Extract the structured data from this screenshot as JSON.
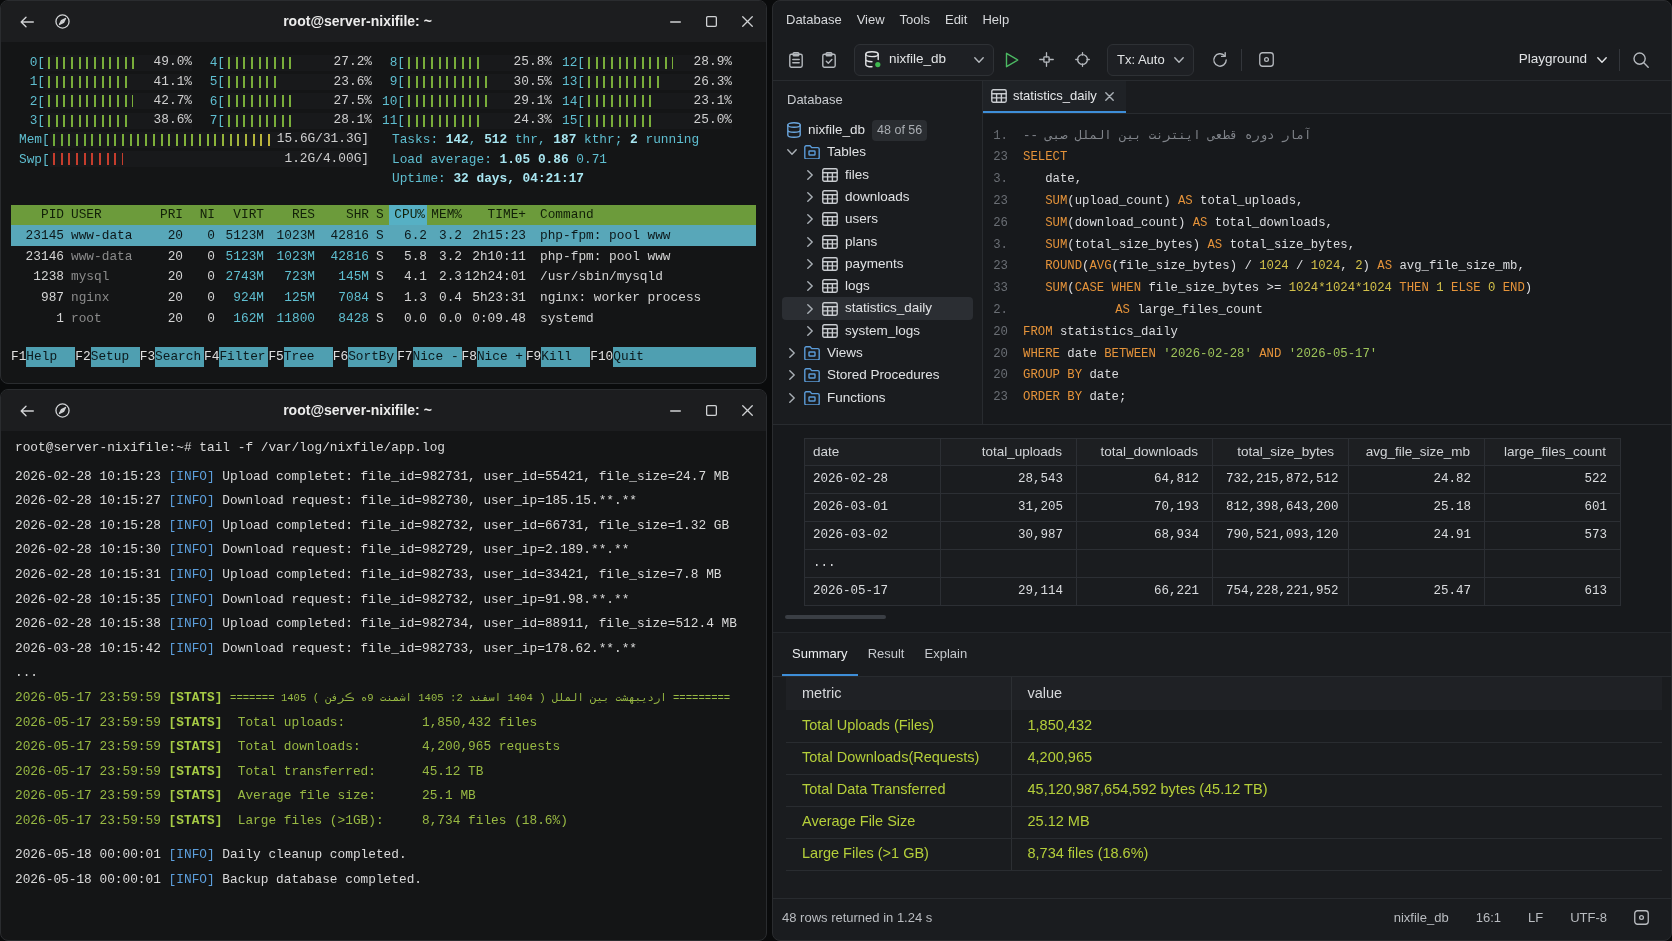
{
  "htop_window": {
    "title": "root@server-nixifile: ~",
    "cpu_meters": [
      {
        "label": "0[",
        "level": 0.61,
        "reading": "49.0%"
      },
      {
        "label": "1[",
        "level": 0.56,
        "reading": "41.1%"
      },
      {
        "label": "2[",
        "level": 0.6,
        "reading": "42.7%"
      },
      {
        "label": "3[",
        "level": 0.56,
        "reading": "38.6%"
      },
      {
        "label": "4[",
        "level": 0.49,
        "reading": "27.2%"
      },
      {
        "label": "5[",
        "level": 0.35,
        "reading": "23.6%"
      },
      {
        "label": "6[",
        "level": 0.45,
        "reading": "27.5%"
      },
      {
        "label": "7[",
        "level": 0.45,
        "reading": "28.1%"
      },
      {
        "label": "8[",
        "level": 0.52,
        "reading": "25.8%"
      },
      {
        "label": "9[",
        "level": 0.56,
        "reading": "30.5%"
      },
      {
        "label": "10[",
        "level": 0.56,
        "reading": "29.1%"
      },
      {
        "label": "11[",
        "level": 0.52,
        "reading": "24.3%"
      },
      {
        "label": "12[",
        "level": 0.6,
        "reading": "28.9%"
      },
      {
        "label": "13[",
        "level": 0.51,
        "reading": "26.3%"
      },
      {
        "label": "14[",
        "level": 0.45,
        "reading": "23.1%"
      },
      {
        "label": "15[",
        "level": 0.47,
        "reading": "25.0%"
      }
    ],
    "memory_meters": [
      {
        "kind": "mem",
        "label": "Mem[",
        "level": 0.71,
        "reading": "15.6G/31.3G]"
      },
      {
        "kind": "swap",
        "label": "Swp[",
        "level": 0.23,
        "reading": "1.2G/4.00G]"
      }
    ],
    "system_info": [
      {
        "label": "Tasks:",
        "value": "**142**, **512** thr, **187** kthr; **2** running"
      },
      {
        "label": "Load average:",
        "value": "**1.05** **0.86** 0.71"
      },
      {
        "label": "Uptime:",
        "value": "**32 days, 04:21:17**"
      }
    ],
    "process_table": {
      "columns": [
        {
          "label": "PID",
          "sorted": false
        },
        {
          "label": "USER",
          "sorted": false
        },
        {
          "label": "PRI",
          "sorted": false
        },
        {
          "label": "NI",
          "sorted": false
        },
        {
          "label": "VIRT",
          "sorted": false
        },
        {
          "label": "RES",
          "sorted": false
        },
        {
          "label": "SHR",
          "sorted": false
        },
        {
          "label": "S",
          "sorted": false
        },
        {
          "label": "CPU%",
          "sorted": true
        },
        {
          "label": "MEM%",
          "sorted": false
        },
        {
          "label": "TIME+",
          "sorted": false
        },
        {
          "label": "Command",
          "sorted": false
        }
      ],
      "rows": [
        {
          "selected": true,
          "cells": [
            "23145",
            "www-data",
            "20",
            "0",
            "5123M",
            "1023M",
            "42816",
            "S",
            "6.2",
            "3.2",
            "2h15:23",
            "php-fpm: pool www"
          ]
        },
        {
          "selected": false,
          "cells": [
            "23146",
            "www-data",
            "20",
            "0",
            "5123M",
            "1023M",
            "42816",
            "S",
            "5.8",
            "3.2",
            "2h10:11",
            "php-fpm: pool www"
          ]
        },
        {
          "selected": false,
          "cells": [
            "1238",
            "mysql",
            "20",
            "0",
            "2743M",
            "723M",
            "145M",
            "S",
            "4.1",
            "2.3",
            "12h24:01",
            "/usr/sbin/mysqld"
          ]
        },
        {
          "selected": false,
          "cells": [
            "987",
            "nginx",
            "20",
            "0",
            "924M",
            "125M",
            "7084",
            "S",
            "1.3",
            "0.4",
            "5h23:31",
            "nginx: worker process"
          ]
        },
        {
          "selected": false,
          "cells": [
            "1",
            "root",
            "20",
            "0",
            "162M",
            "11800",
            "8428",
            "S",
            "0.0",
            "0.0",
            "0:09.48",
            "systemd"
          ]
        }
      ]
    },
    "function_keys": [
      {
        "key": "F1",
        "label": "Help"
      },
      {
        "key": "F2",
        "label": "Setup"
      },
      {
        "key": "F3",
        "label": "Search"
      },
      {
        "key": "F4",
        "label": "Filter"
      },
      {
        "key": "F5",
        "label": "Tree"
      },
      {
        "key": "F6",
        "label": "SortBy"
      },
      {
        "key": "F7",
        "label": "Nice -"
      },
      {
        "key": "F8",
        "label": "Nice +"
      },
      {
        "key": "F9",
        "label": "Kill"
      },
      {
        "key": "F10",
        "label": "Quit"
      }
    ]
  },
  "log_window": {
    "title": "root@server-nixifile: ~",
    "prompt": "root@server-nixifile:~# tail -f /var/log/nixfile/app.log",
    "groups": [
      [
        {
          "kind": "info",
          "time": "2026-02-28 10:15:23",
          "tag": "[INFO]",
          "message": "Upload completet: file_id=982731, user_id=55421, file_size=24.7 MB"
        },
        {
          "kind": "info",
          "time": "2026-02-28 10:15:27",
          "tag": "[INFO]",
          "message": "Download request: file_id=982730, user_ip=185.15.**.**"
        },
        {
          "kind": "info",
          "time": "2026-02-28 10:15:28",
          "tag": "[INFO]",
          "message": "Upload completed: file_id=982732, user_id=66731, file_size=1.32 GB"
        },
        {
          "kind": "info",
          "time": "2026-02-28 10:15:30",
          "tag": "[INFO]",
          "message": "Download request: file_id=982729, user_ip=2.189.**.**"
        },
        {
          "kind": "info",
          "time": "2026-02-28 10:15:31",
          "tag": "[INFO]",
          "message": "Upload completed: file_id=982733, user_id=33421, file_size=7.8 MB"
        },
        {
          "kind": "info",
          "time": "2026-02-28 10:15:35",
          "tag": "[INFO]",
          "message": "Download request: file_id=982732, user_ip=91.98.**.**"
        },
        {
          "kind": "info",
          "time": "2026-02-28 10:15:38",
          "tag": "[INFO]",
          "message": "Upload completed: file_id=982734, user_id=88911, file_size=512.4 MB"
        },
        {
          "kind": "info",
          "time": "2026-03-28 10:15:42",
          "tag": "[INFO]",
          "message": "Download request: file_id=982733, user_ip=178.62.**.**"
        },
        {
          "kind": "plain",
          "message": "..."
        },
        {
          "kind": "banner",
          "time": "2026-05-17 23:59:59",
          "tag": "[STATS]",
          "message": "======= 1405 اردیبهشت بین الملل ( 1404 اسفند 2: 1405 اشمنت 9ه ڪرفن ) ========="
        },
        {
          "kind": "stats",
          "time": "2026-05-17 23:59:59",
          "tag": "[STATS]",
          "label": "Total uploads:",
          "value": "1,850,432 files"
        },
        {
          "kind": "stats",
          "time": "2026-05-17 23:59:59",
          "tag": "[STATS]",
          "label": "Total downloads:",
          "value": "4,200,965 requests"
        },
        {
          "kind": "stats",
          "time": "2026-05-17 23:59:59",
          "tag": "[STATS]",
          "label": "Total transferred:",
          "value": "45.12 TB"
        },
        {
          "kind": "stats",
          "time": "2026-05-17 23:59:59",
          "tag": "[STATS]",
          "label": "Average file size:",
          "value": "25.1 MB"
        },
        {
          "kind": "stats",
          "time": "2026-05-17 23:59:59",
          "tag": "[STATS]",
          "label": "Large files (>1GB):",
          "value": "8,734 files (18.6%)"
        }
      ],
      [
        {
          "kind": "info",
          "time": "2026-05-18 00:00:01",
          "tag": "[INFO]",
          "message": "Daily cleanup completed."
        },
        {
          "kind": "info",
          "time": "2026-05-18 00:00:01",
          "tag": "[INFO]",
          "message": "Backup database completed."
        }
      ]
    ]
  },
  "db_app": {
    "menu": [
      "Database",
      "View",
      "Tools",
      "Edit",
      "Help"
    ],
    "toolbar": {
      "database": "nixfile_db",
      "transaction": "Tx: Auto",
      "workspace": "Playground"
    },
    "sidebar": {
      "title": "Database",
      "tree": [
        {
          "kind": "database",
          "label": "nixfile_db",
          "badge": "48 of 56",
          "selected": false
        },
        {
          "kind": "folder",
          "label": "Tables",
          "expanded": true,
          "selected": false,
          "children": [
            {
              "kind": "table",
              "label": "files",
              "expanded": false,
              "selected": false
            },
            {
              "kind": "table",
              "label": "downloads",
              "expanded": false,
              "selected": false
            },
            {
              "kind": "table",
              "label": "users",
              "expanded": false,
              "selected": false
            },
            {
              "kind": "table",
              "label": "plans",
              "expanded": false,
              "selected": false
            },
            {
              "kind": "table",
              "label": "payments",
              "expanded": false,
              "selected": false
            },
            {
              "kind": "table",
              "label": "logs",
              "expanded": false,
              "selected": false
            },
            {
              "kind": "table",
              "label": "statistics_daily",
              "expanded": false,
              "selected": true
            },
            {
              "kind": "table",
              "label": "system_logs",
              "expanded": false,
              "selected": false
            }
          ]
        },
        {
          "kind": "folder",
          "label": "Views",
          "expanded": false,
          "selected": false
        },
        {
          "kind": "folder",
          "label": "Stored Procedures",
          "expanded": false,
          "selected": false
        },
        {
          "kind": "folder",
          "label": "Functions",
          "expanded": false,
          "selected": false
        }
      ]
    },
    "editor": {
      "tab": {
        "label": "statistics_daily",
        "selected": true
      },
      "lines": [
        {
          "number": "1.",
          "kind": "clause",
          "tokens": [
            {
              "kind": "comment",
              "text": "-- آمار دوره قطعی اینترنت بین الملل صبی"
            }
          ]
        },
        {
          "number": "23",
          "kind": "clause",
          "tokens": [
            {
              "kind": "keyword",
              "text": "SELECT"
            }
          ]
        },
        {
          "number": "3.",
          "kind": "column",
          "tokens": [
            {
              "kind": "name",
              "text": "date,"
            }
          ]
        },
        {
          "number": "23",
          "kind": "column",
          "tokens": [
            {
              "kind": "keyword",
              "text": "SUM"
            },
            {
              "kind": "name",
              "text": "(upload_count) "
            },
            {
              "kind": "keyword",
              "text": "AS"
            },
            {
              "kind": "name",
              "text": " total_uploads,"
            }
          ]
        },
        {
          "number": "26",
          "kind": "column",
          "tokens": [
            {
              "kind": "keyword",
              "text": "SUM"
            },
            {
              "kind": "name",
              "text": "(download_count) "
            },
            {
              "kind": "keyword",
              "text": "AS"
            },
            {
              "kind": "name",
              "text": " total_downloads,"
            }
          ]
        },
        {
          "number": "3.",
          "kind": "column",
          "tokens": [
            {
              "kind": "keyword",
              "text": "SUM"
            },
            {
              "kind": "name",
              "text": "(total_size_bytes) "
            },
            {
              "kind": "keyword",
              "text": "AS"
            },
            {
              "kind": "name",
              "text": " total_size_bytes,"
            }
          ]
        },
        {
          "number": "23",
          "kind": "column",
          "tokens": [
            {
              "kind": "keyword",
              "text": "ROUND"
            },
            {
              "kind": "name",
              "text": "("
            },
            {
              "kind": "keyword",
              "text": "AVG"
            },
            {
              "kind": "name",
              "text": "(file_size_bytes) / "
            },
            {
              "kind": "number",
              "text": "1024"
            },
            {
              "kind": "name",
              "text": " / "
            },
            {
              "kind": "number",
              "text": "1024"
            },
            {
              "kind": "name",
              "text": ", "
            },
            {
              "kind": "number",
              "text": "2"
            },
            {
              "kind": "name",
              "text": ") "
            },
            {
              "kind": "keyword",
              "text": "AS"
            },
            {
              "kind": "name",
              "text": " avg_file_size_mb,"
            }
          ]
        },
        {
          "number": "33",
          "kind": "column",
          "tokens": [
            {
              "kind": "keyword",
              "text": "SUM"
            },
            {
              "kind": "name",
              "text": "("
            },
            {
              "kind": "keyword",
              "text": "CASE WHEN"
            },
            {
              "kind": "name",
              "text": " file_size_bytes >= "
            },
            {
              "kind": "number",
              "text": "1024*1024*1024"
            },
            {
              "kind": "keyword",
              "text": " THEN"
            },
            {
              "kind": "number",
              "text": " 1"
            },
            {
              "kind": "keyword",
              "text": " ELSE"
            },
            {
              "kind": "number",
              "text": " 0"
            },
            {
              "kind": "keyword",
              "text": " END"
            },
            {
              "kind": "name",
              "text": ")"
            }
          ]
        },
        {
          "number": "2.",
          "kind": "continuation",
          "tokens": [
            {
              "kind": "keyword",
              "text": "AS"
            },
            {
              "kind": "name",
              "text": " large_files_count"
            }
          ]
        },
        {
          "number": "20",
          "kind": "clause",
          "tokens": [
            {
              "kind": "keyword",
              "text": "FROM"
            },
            {
              "kind": "name",
              "text": " statistics_daily"
            }
          ]
        },
        {
          "number": "20",
          "kind": "clause",
          "tokens": [
            {
              "kind": "keyword",
              "text": "WHERE"
            },
            {
              "kind": "name",
              "text": " date "
            },
            {
              "kind": "keyword",
              "text": "BETWEEN"
            },
            {
              "kind": "string",
              "text": " '2026-02-28'"
            },
            {
              "kind": "keyword",
              "text": " AND"
            },
            {
              "kind": "string",
              "text": " '2026-05-17'"
            }
          ]
        },
        {
          "number": "20",
          "kind": "clause",
          "tokens": [
            {
              "kind": "keyword",
              "text": "GROUP BY"
            },
            {
              "kind": "name",
              "text": " date"
            }
          ]
        },
        {
          "number": "23",
          "kind": "clause",
          "tokens": [
            {
              "kind": "keyword",
              "text": "ORDER BY"
            },
            {
              "kind": "name",
              "text": " date;"
            }
          ]
        }
      ]
    },
    "results": {
      "columns": [
        "date",
        "total_uploads",
        "total_downloads",
        "total_size_bytes",
        "avg_file_size_mb",
        "large_files_count"
      ],
      "rows": [
        {
          "cells": [
            "2026-02-28",
            "28,543",
            "64,812",
            "732,215,872,512",
            "24.82",
            "522"
          ]
        },
        {
          "cells": [
            "2026-03-01",
            "31,205",
            "70,193",
            "812,398,643,200",
            "25.18",
            "601"
          ]
        },
        {
          "cells": [
            "2026-03-02",
            "30,987",
            "68,934",
            "790,521,093,120",
            "24.91",
            "573"
          ]
        },
        {
          "cells": [
            "..."
          ]
        },
        {
          "cells": [
            "2026-05-17",
            "29,114",
            "66,221",
            "754,228,221,952",
            "25.47",
            "613"
          ]
        }
      ]
    },
    "output_tabs": [
      {
        "label": "Summary",
        "selected": true
      },
      {
        "label": "Result",
        "selected": false
      },
      {
        "label": "Explain",
        "selected": false
      }
    ],
    "summary": {
      "columns": [
        "metric",
        "value"
      ],
      "rows": [
        {
          "metric": "Total Uploads (Files)",
          "value": "1,850,432"
        },
        {
          "metric": "Total Downloads(Requests)",
          "value": "4,200,965"
        },
        {
          "metric": "Total Data Transferred",
          "value": "45,120,987,654,592 bytes (45.12 TB)"
        },
        {
          "metric": "Average File Size",
          "value": "25.12 MB"
        },
        {
          "metric": "Large Files (>1 GB)",
          "value": "8,734 files (18.6%)"
        }
      ]
    },
    "status_bar": {
      "message": "48 rows returned in 1.24 s",
      "items": [
        "nixfile_db",
        "16:1",
        "LF",
        "UTF-8"
      ]
    }
  }
}
